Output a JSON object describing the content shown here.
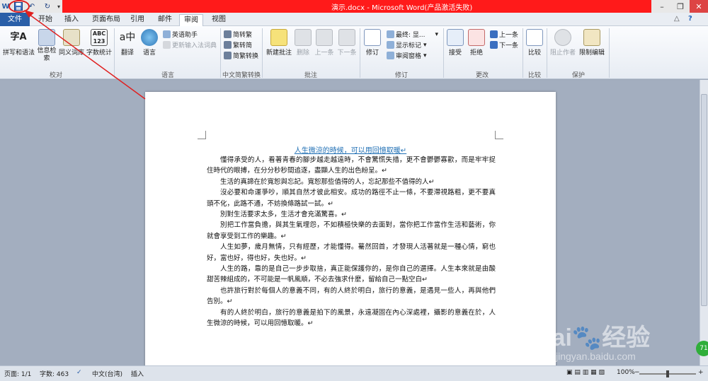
{
  "window": {
    "title": "演示.docx - Microsoft Word(产品激活失败)",
    "minimize_glyph": "–",
    "restore_glyph": "❐",
    "close_glyph": "✕",
    "help_glyph": "?"
  },
  "qat": {
    "save_icon": "save-icon",
    "undo_glyph": "↶",
    "redo_glyph": "↻"
  },
  "tabs": {
    "file": "文件",
    "items": [
      "开始",
      "插入",
      "页面布局",
      "引用",
      "邮件",
      "审阅",
      "视图"
    ],
    "active": "审阅"
  },
  "ribbon": {
    "groups": {
      "proofing": "校对",
      "language": "语言",
      "chinese_conv": "中文简繁转换",
      "comments": "批注",
      "tracking": "修订",
      "changes": "更改",
      "compare": "比较",
      "protect": "保护"
    },
    "buttons": {
      "spelling": "拼写和语法",
      "research": "信息检索",
      "thesaurus": "同义词库",
      "wordcount": "字数统计",
      "translate": "翻译",
      "language": "语言",
      "english_assistant": "英语助手",
      "update_ime": "更新输入法词典",
      "to_traditional": "简转繁",
      "to_simplified": "繁转简",
      "conversion": "简繁转换",
      "new_comment": "新建批注",
      "delete": "删除",
      "prev_comment": "上一条",
      "next_comment": "下一条",
      "track_changes": "修订",
      "final_show": "最终: 显...",
      "show_markup": "显示标记",
      "review_pane": "审阅窗格",
      "accept": "接受",
      "reject": "拒绝",
      "prev_change": "上一条",
      "next_change": "下一条",
      "compare": "比较",
      "block_authors": "阻止作者",
      "restrict_editing": "限制编辑"
    }
  },
  "document": {
    "title": "人生微涼的時候，可以用回憶取暖↵",
    "paragraphs": [
      "懂得承受的人，看著青春的腳步越走越遠時，不會驚慌失措，更不會鬱鬱寡歡，而是牢牢捉住時代的眼搏，在分分秒秒間追逐，盡顯人生的出色紛呈。↵",
      "生活的真諦在於寬恕與忘記。寬恕那些值得的人，忘記那些不值得的人↵",
      "沒必要和命運爭吵，順其自然才彼此相安。成功的路徑不止一條，不要滯視路粗，更不要真頭不化，此路不通，不妨換條路試一試。↵",
      "別對生活要求太多，生活才會充滿驚喜。↵",
      "別把工作當負擔，與其生氣埋怨，不如積極快樂的去面對，當你把工作當作生活和藝術，你就會享受到工作的樂趣。↵",
      "人生如夢，歲月無情，只有經歷，才能懂得。驀然回首，才發現人活著就是一種心情，窮也好，富也好，得也好，失也好。↵",
      "人生的路，靠的是自己一步步取捨，真正能保護你的，是你自己的選擇。人生本來就是由酸甜苦辣組成的，不可能是一帆風順，不必去強求什麼，留給自己一點空白↵",
      "也許旅行對於每個人的意義不同，有的人終於明白，旅行的意義，是遇見一些人，再與他們告別。↵",
      "有的人終於明白，旅行的意義是拍下的風景，永遠凝固在內心深處裡，攝影的意義在於，人生微涼的時候，可以用回憶取暖。↵"
    ]
  },
  "status": {
    "page": "页面: 1/1",
    "wordcount": "字数: 463",
    "language": "中文(台湾)",
    "mode": "插入",
    "zoom": "100%",
    "zoom_out": "−",
    "zoom_in": "+"
  },
  "watermark": {
    "brand": "Bai",
    "brand_cn": "经验",
    "url": "jingyan.baidu.com"
  },
  "badge": {
    "value": "71"
  },
  "colors": {
    "titlebar_red": "#ff1a1a",
    "file_tab": "#2a5fa8",
    "annotation": "#e02020"
  }
}
